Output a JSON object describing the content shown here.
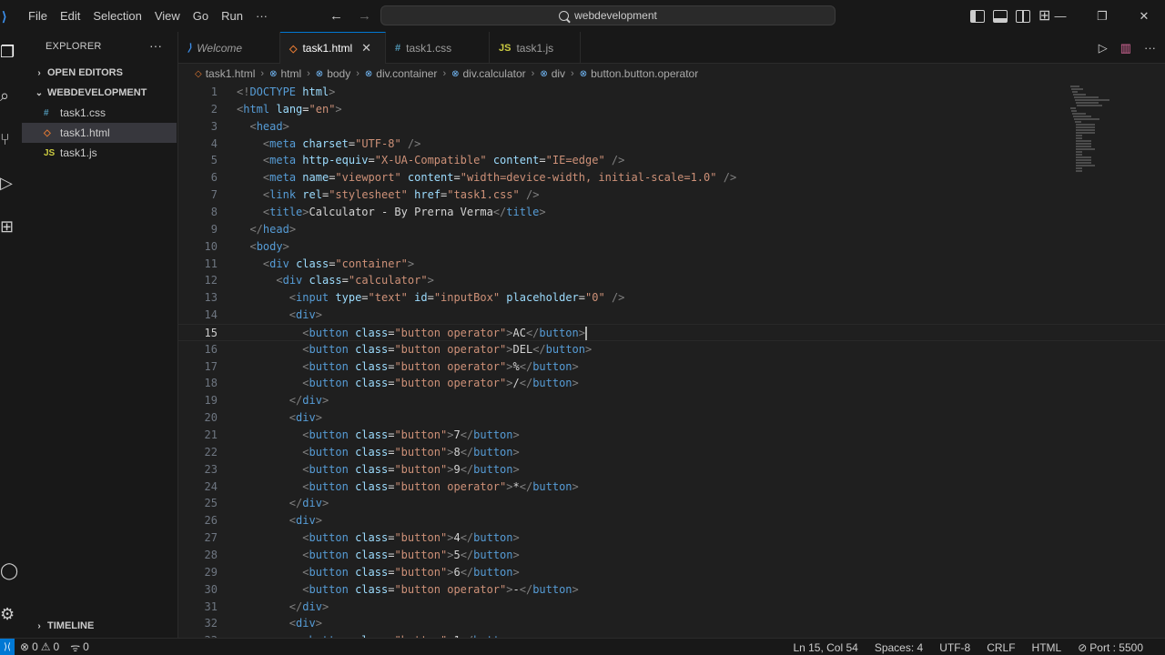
{
  "titlebar": {
    "menu": [
      "File",
      "Edit",
      "Selection",
      "View",
      "Go",
      "Run",
      "···"
    ],
    "search": "webdevelopment",
    "window_controls": [
      "—",
      "❐",
      "✕"
    ]
  },
  "sidebar": {
    "title": "EXPLORER",
    "more": "···",
    "open_editors": "OPEN EDITORS",
    "folder": "WEBDEVELOPMENT",
    "files": [
      {
        "name": "task1.css",
        "icon": "#"
      },
      {
        "name": "task1.html",
        "icon": "◇"
      },
      {
        "name": "task1.js",
        "icon": "JS"
      }
    ],
    "timeline": "TIMELINE"
  },
  "tabs": [
    {
      "label": "Welcome",
      "icon": "⟩"
    },
    {
      "label": "task1.html",
      "icon": "◇",
      "close": "✕"
    },
    {
      "label": "task1.css",
      "icon": "#"
    },
    {
      "label": "task1.js",
      "icon": "JS"
    }
  ],
  "breadcrumb": [
    "task1.html",
    "html",
    "body",
    "div.container",
    "div.calculator",
    "div",
    "button.button.operator"
  ],
  "code": {
    "current_line": 15,
    "lines": [
      {
        "n": "1",
        "html": "<span class='t-br'>&lt;!</span><span class='t-tag'>DOCTYPE</span> <span class='t-attr'>html</span><span class='t-br'>&gt;</span>"
      }
    ]
  },
  "status": {
    "errors": "0",
    "warnings": "0",
    "ports": "0",
    "position": "Ln 15, Col 54",
    "spaces": "Spaces: 4",
    "encoding": "UTF-8",
    "eol": "CRLF",
    "language": "HTML",
    "port": "Port : 5500"
  },
  "colors": {
    "accent": "#0078d4",
    "tag": "#569cd6",
    "attr": "#9cdcfe",
    "string": "#ce9178"
  }
}
